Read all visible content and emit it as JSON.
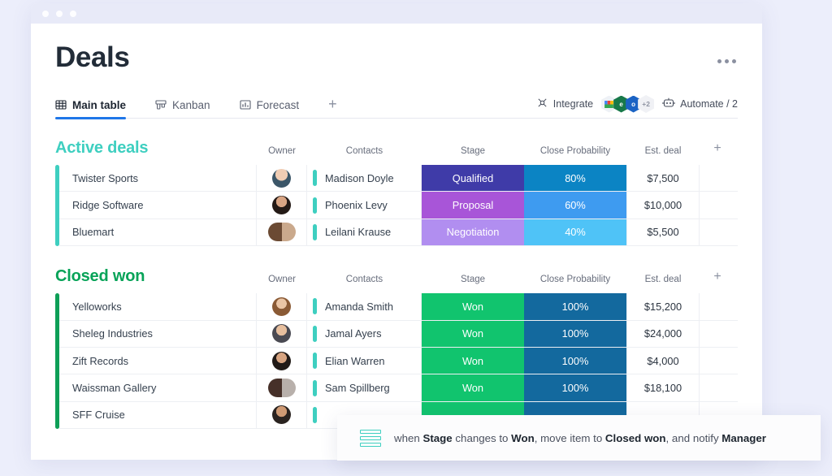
{
  "window": {
    "dots": 3
  },
  "header": {
    "title": "Deals",
    "menu_icon": "kebab-menu-icon"
  },
  "tabs": {
    "items": [
      {
        "label": "Main table",
        "icon": "grid-icon",
        "active": true
      },
      {
        "label": "Kanban",
        "icon": "kanban-board-icon",
        "active": false
      },
      {
        "label": "Forecast",
        "icon": "bar-chart-icon",
        "active": false
      }
    ],
    "add_label": "+",
    "right": {
      "integrate_label": "Integrate",
      "integrate_icon": "integrations-icon",
      "apps": [
        {
          "name": "gmail-app-icon",
          "color": "#f2f5f9",
          "glyph": ""
        },
        {
          "name": "excel-app-icon",
          "color": "#1a7245",
          "glyph": "e"
        },
        {
          "name": "outlook-app-icon",
          "color": "#1b63c4",
          "glyph": "o"
        }
      ],
      "apps_overflow": "+2",
      "automate_label": "Automate / 2",
      "automate_icon": "robot-icon"
    }
  },
  "columns": {
    "owner": "Owner",
    "contacts": "Contacts",
    "stage": "Stage",
    "probability": "Close Probability",
    "deal": "Est. deal",
    "add": "+"
  },
  "groups": [
    {
      "name": "Active deals",
      "accent": "#3ecfc0",
      "name_color": "#3ecfc0",
      "rows": [
        {
          "name": "Twister Sports",
          "avatar": "avatar-male-1",
          "duo": false,
          "contact": "Madison Doyle",
          "stage": "Qualified",
          "stage_color": "#3f3ba8",
          "probability": "80%",
          "prob_color": "#0b84c4",
          "deal": "$7,500"
        },
        {
          "name": "Ridge Software",
          "avatar": "avatar-female-1",
          "duo": false,
          "contact": "Phoenix Levy",
          "stage": "Proposal",
          "stage_color": "#a martin",
          "probability": "60%",
          "prob_color": "#3e9bf0",
          "deal": "$10,000"
        },
        {
          "name": "Bluemart",
          "avatar": "avatar-pair-1",
          "duo": true,
          "contact": "Leilani Krause",
          "stage": "Negotiation",
          "stage_color": "#b18ef0",
          "probability": "40%",
          "prob_color": "#4fc3f7",
          "deal": "$5,500"
        }
      ]
    },
    {
      "name": "Closed won",
      "accent": "#0e9f57",
      "name_color": "#07a358",
      "rows": [
        {
          "name": "Yelloworks",
          "avatar": "avatar-female-2",
          "duo": false,
          "contact": "Amanda Smith",
          "stage": "Won",
          "stage_color": "#11c46e",
          "probability": "100%",
          "prob_color": "#13699e",
          "deal": "$15,200"
        },
        {
          "name": "Sheleg Industries",
          "avatar": "avatar-male-2",
          "duo": false,
          "contact": "Jamal Ayers",
          "stage": "Won",
          "stage_color": "#11c46e",
          "probability": "100%",
          "prob_color": "#13699e",
          "deal": "$24,000"
        },
        {
          "name": "Zift Records",
          "avatar": "avatar-female-3",
          "duo": false,
          "contact": "Elian Warren",
          "stage": "Won",
          "stage_color": "#11c46e",
          "probability": "100%",
          "prob_color": "#13699e",
          "deal": "$4,000"
        },
        {
          "name": "Waissman Gallery",
          "avatar": "avatar-pair-2",
          "duo": true,
          "contact": "Sam Spillberg",
          "stage": "Won",
          "stage_color": "#11c46e",
          "probability": "100%",
          "prob_color": "#13699e",
          "deal": "$18,100"
        },
        {
          "name": "SFF Cruise",
          "avatar": "avatar-male-3",
          "duo": false,
          "contact": "",
          "stage": "",
          "stage_color": "#11c46e",
          "probability": "",
          "prob_color": "#13699e",
          "deal": ""
        }
      ]
    }
  ],
  "toast": {
    "icon": "automation-recipe-icon",
    "parts": [
      {
        "text": "when ",
        "bold": false
      },
      {
        "text": "Stage",
        "bold": true
      },
      {
        "text": " changes to ",
        "bold": false
      },
      {
        "text": "Won",
        "bold": true
      },
      {
        "text": ", move item to ",
        "bold": false
      },
      {
        "text": "Closed won",
        "bold": true
      },
      {
        "text": ", and notify ",
        "bold": false
      },
      {
        "text": "Manager",
        "bold": true
      }
    ]
  }
}
